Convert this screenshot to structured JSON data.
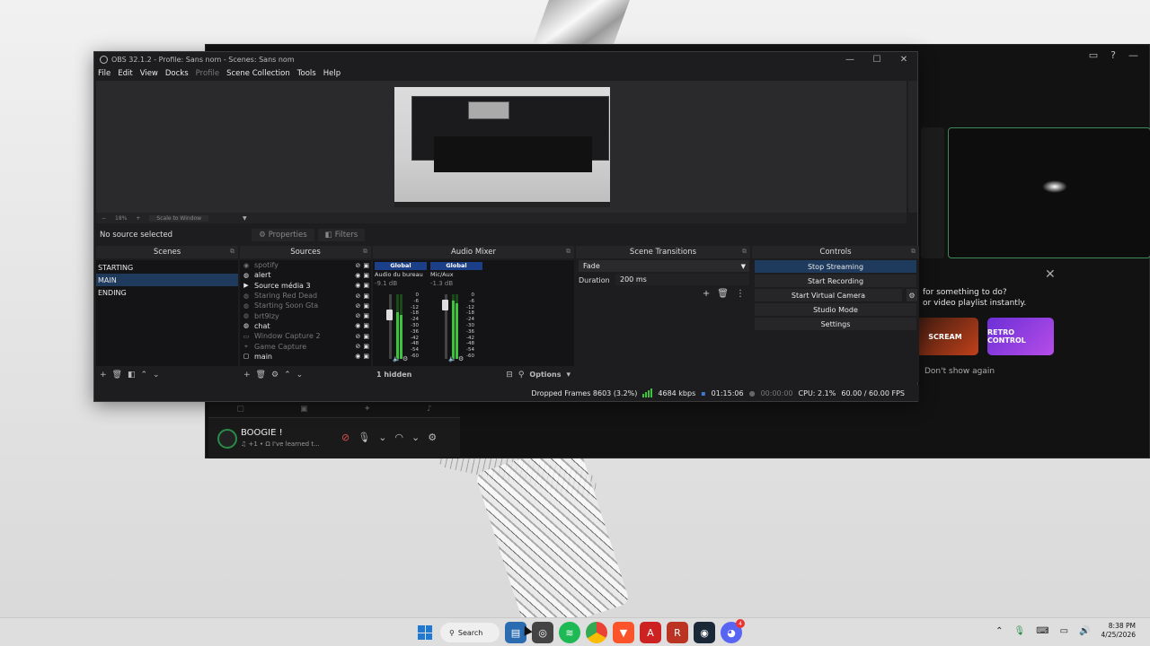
{
  "obs": {
    "title": "OBS 32.1.2 - Profile: Sans nom - Scenes: Sans nom",
    "menu": [
      "File",
      "Edit",
      "View",
      "Docks",
      "Profile",
      "Scene Collection",
      "Tools",
      "Help"
    ],
    "zoom": {
      "minus": "−",
      "percent": "18%",
      "plus": "+",
      "fit": "Scale to Window"
    },
    "no_source": "No source selected",
    "properties_btn": "Properties",
    "filters_btn": "Filters",
    "docks": {
      "scenes": "Scenes",
      "sources": "Sources",
      "mixer": "Audio Mixer",
      "transitions": "Scene Transitions",
      "controls": "Controls"
    },
    "scenes": [
      "STARTING",
      "MAIN",
      "ENDING"
    ],
    "selected_scene": "MAIN",
    "sources": [
      {
        "name": "spotify",
        "icon": "spotify-icon",
        "visible": false
      },
      {
        "name": "alert",
        "icon": "browser-icon",
        "visible": true
      },
      {
        "name": "Source média 3",
        "icon": "media-play-icon",
        "visible": true
      },
      {
        "name": "Staring Red Dead",
        "icon": "browser-icon",
        "visible": false
      },
      {
        "name": "Starting Soon Gta",
        "icon": "browser-icon",
        "visible": false
      },
      {
        "name": "brt9lzy",
        "icon": "browser-icon",
        "visible": false
      },
      {
        "name": "chat",
        "icon": "browser-icon",
        "visible": true
      },
      {
        "name": "Window Capture 2",
        "icon": "window-icon",
        "visible": false
      },
      {
        "name": "Game Capture",
        "icon": "gamepad-icon",
        "visible": false
      },
      {
        "name": "main",
        "icon": "monitor-icon",
        "visible": true
      }
    ],
    "mixer": {
      "channels": [
        {
          "tag": "Global",
          "device": "Audio du bureau",
          "db": "-9.1 dB",
          "level": 0.72
        },
        {
          "tag": "Global",
          "device": "Mic/Aux",
          "db": "-1.3 dB",
          "level": 0.9
        }
      ],
      "scale": [
        "0",
        "-6",
        "-12",
        "-18",
        "-24",
        "-30",
        "-36",
        "-42",
        "-48",
        "-54",
        "-60"
      ],
      "hidden": "1 hidden",
      "options": "Options"
    },
    "transition": {
      "type": "Fade",
      "duration_label": "Duration",
      "duration": "200 ms"
    },
    "controls": [
      "Stop Streaming",
      "Start Recording",
      "Start Virtual Camera",
      "Studio Mode",
      "Settings"
    ],
    "status": {
      "dropped": "Dropped Frames 8603 (3.2%)",
      "kbps": "4684 kbps",
      "stream_time": "01:15:06",
      "rec_time": "00:00:00",
      "cpu": "CPU: 2.1%",
      "fps": "60.00 / 60.00 FPS"
    }
  },
  "bg_app": {
    "prompt1": "for something to do?",
    "prompt2": "or video playlist instantly.",
    "dont_show": "Don't show again",
    "thumb1": "SCREAM",
    "thumb2": "RETRO CONTROL",
    "user_name": "BOOGIE !",
    "user_status": "♫ +1 • Ω I've learned t..."
  },
  "taskbar": {
    "search": "Search",
    "time": "8:38 PM",
    "date": "4/25/2026",
    "discord_badge": "4"
  }
}
